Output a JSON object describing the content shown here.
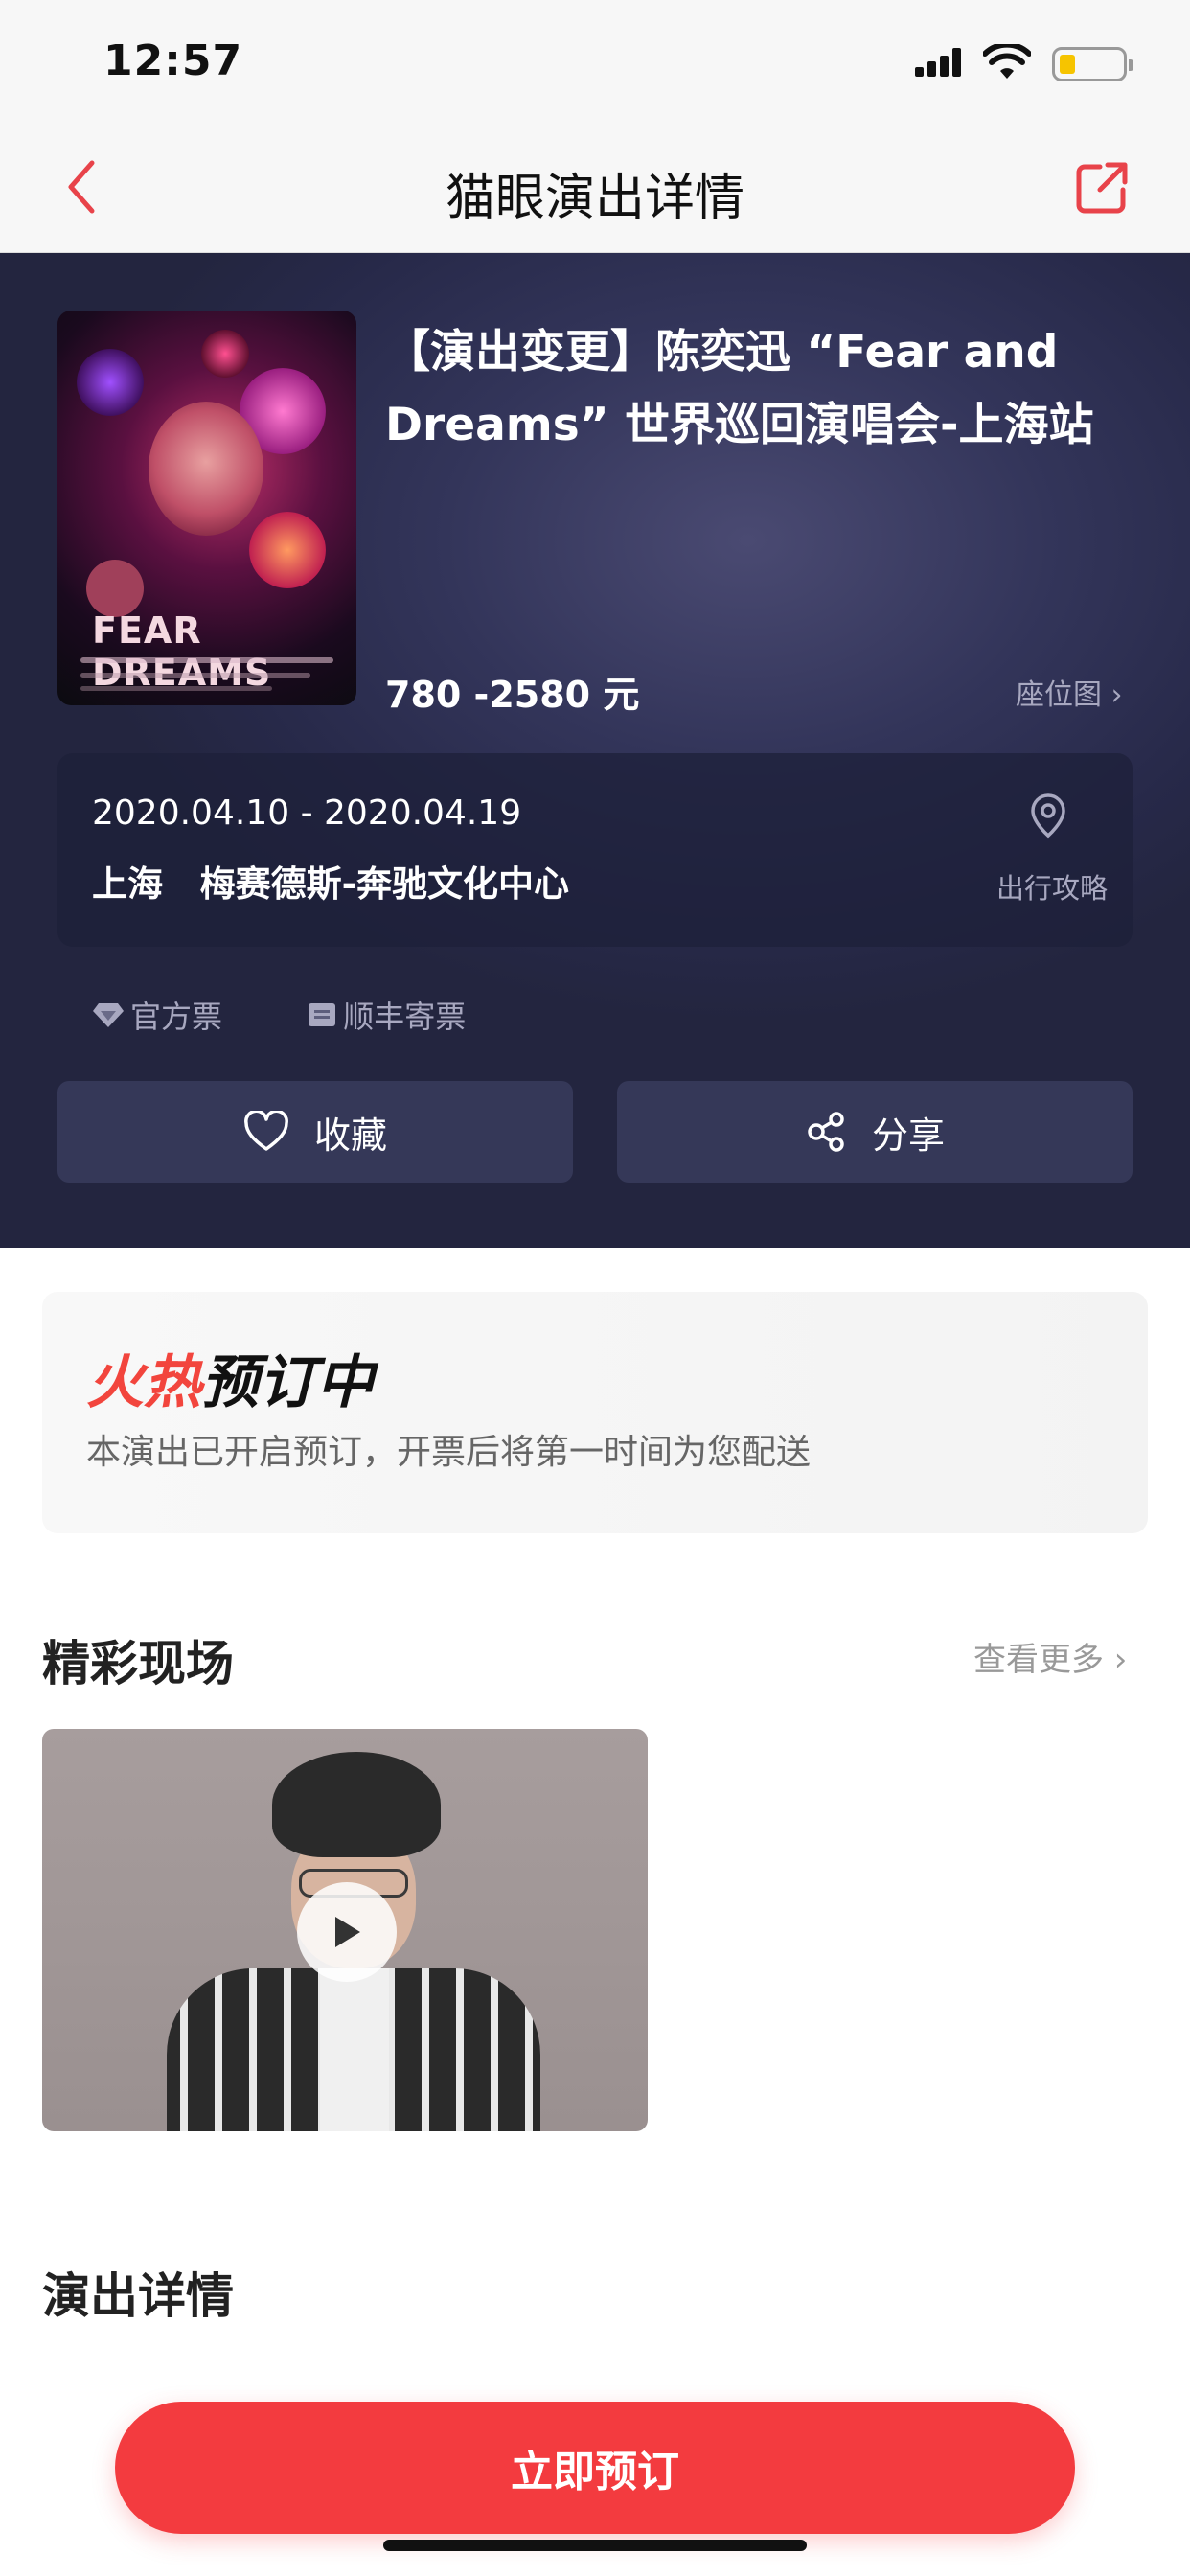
{
  "status_bar": {
    "time": "12:57"
  },
  "nav": {
    "title": "猫眼演出详情"
  },
  "show": {
    "title": "【演出变更】陈奕迅 “Fear and Dreams” 世界巡回演唱会-上海站",
    "price": "780 -2580 元",
    "seat_map_label": "座位图",
    "poster_text": "FEAR DREAMS",
    "date": "2020.04.10 - 2020.04.19",
    "city": "上海",
    "venue": "梅赛德斯-奔驰文化中心",
    "guide_label": "出行攻略",
    "tags": [
      "官方票",
      "顺丰寄票"
    ],
    "favorite_label": "收藏",
    "share_label": "分享"
  },
  "booking": {
    "title_hot": "火热",
    "title_rest": "预订中",
    "description": "本演出已开启预订，开票后将第一时间为您配送"
  },
  "highlights": {
    "title": "精彩现场",
    "more_label": "查看更多"
  },
  "details": {
    "title": "演出详情"
  },
  "cta": {
    "label": "立即预订"
  },
  "colors": {
    "accent": "#f33b3f",
    "hero_bg": "#2b2d4f",
    "hot_text": "#f2453d"
  }
}
